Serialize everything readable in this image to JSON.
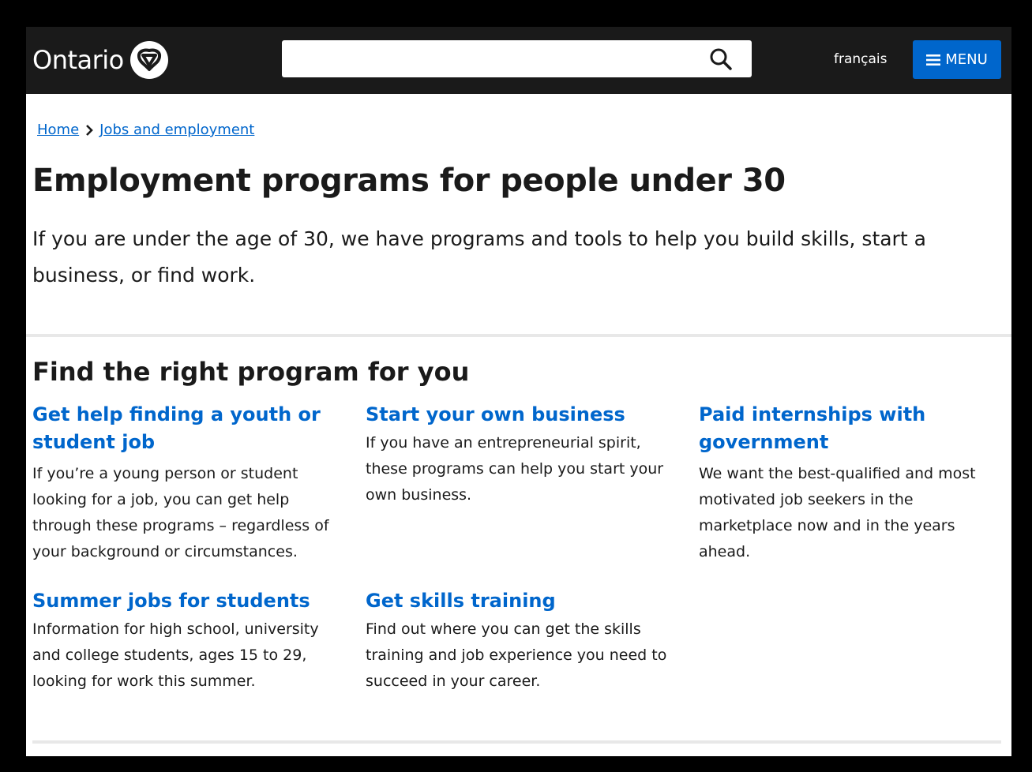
{
  "header": {
    "logo_text": "Ontario",
    "search_placeholder": "",
    "language_link": "français",
    "menu_label": "MENU"
  },
  "breadcrumb": {
    "items": [
      "Home",
      "Jobs and employment"
    ]
  },
  "page": {
    "title": "Employment programs for people under 30",
    "lead": "If you are under the age of 30, we have programs and tools to help you build skills, start a business, or find work."
  },
  "section": {
    "title": "Find the right program for you",
    "cards": [
      {
        "heading": "Get help finding a youth or student job",
        "description": "If you’re a young person or student looking for a job, you can get help through these programs – regardless of your background or circumstances."
      },
      {
        "heading": "Start your own business",
        "description": "If you have an entrepreneurial spirit, these programs can help you start your own business."
      },
      {
        "heading": "Paid internships with government",
        "description": "We want the best-qualified and most motivated job seekers in the marketplace now and in the years ahead."
      },
      {
        "heading": "Summer jobs for students",
        "description": "Information for high school, university and college students, ages 15 to 29, looking for work this summer."
      },
      {
        "heading": "Get skills training",
        "description": "Find out where you can get the skills training and job experience you need to succeed in your career."
      }
    ]
  },
  "colors": {
    "header_bg": "#1a1a1a",
    "link_blue": "#0066cc",
    "text": "#1a1a1a",
    "outer_bg": "#000000"
  },
  "icons": {
    "logo": "trillium-icon",
    "search": "search-icon",
    "menu": "hamburger-icon",
    "breadcrumb_separator": "chevron-right-icon"
  }
}
